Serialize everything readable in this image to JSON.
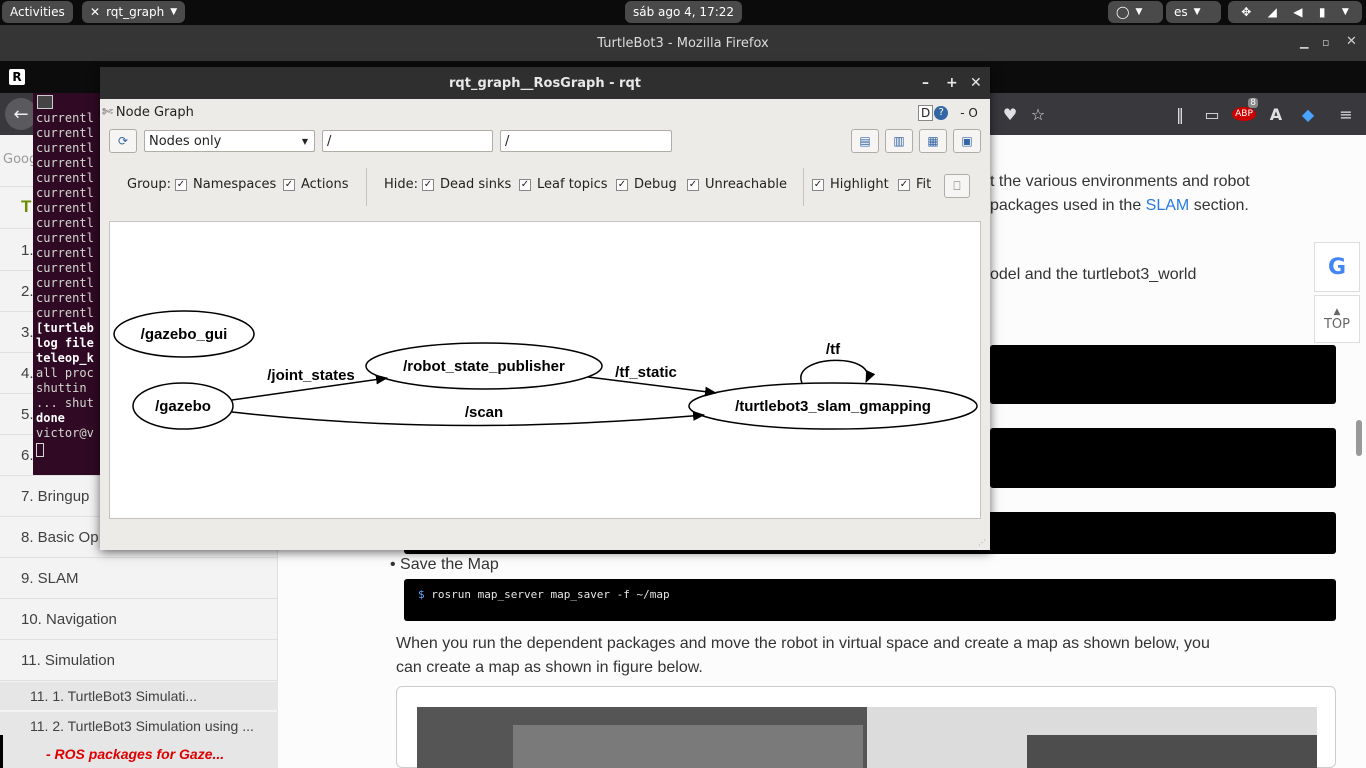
{
  "topbar": {
    "activities": "Activities",
    "app_name": "rqt_graph",
    "clock": "sáb ago  4, 17:22",
    "language": "es"
  },
  "firefox": {
    "window_title": "TurtleBot3 - Mozilla Firefox",
    "addon_badge": "8"
  },
  "terminal": {
    "lines": [
      "currentl",
      "currentl",
      "currentl",
      "currentl",
      "currentl",
      "currentl",
      "currentl",
      "currentl",
      "currentl",
      "currentl",
      "currentl",
      "currentl",
      "currentl",
      "currentl",
      "[turtleb",
      "log file",
      "teleop_k",
      "all proc",
      "shuttin",
      "... shut",
      "done",
      "victor@v"
    ]
  },
  "rqt": {
    "window_title": "rqt_graph__RosGraph - rqt",
    "plugin_title": "Node Graph",
    "help_d": "D",
    "help_o": "- O",
    "display_mode": "Nodes only",
    "ns_filter": "/",
    "topic_filter": "/",
    "group_label": "Group:",
    "namespaces": "Namespaces",
    "actions": "Actions",
    "hide_label": "Hide:",
    "dead_sinks": "Dead sinks",
    "leaf_topics": "Leaf topics",
    "debug": "Debug",
    "unreachable": "Unreachable",
    "highlight": "Highlight",
    "fit": "Fit",
    "checkmark": "✓"
  },
  "graph": {
    "nodes": {
      "gazebo_gui": "/gazebo_gui",
      "gazebo": "/gazebo",
      "robot_state_publisher": "/robot_state_publisher",
      "slam_gmapping": "/turtlebot3_slam_gmapping"
    },
    "edges": {
      "joint_states": "/joint_states",
      "scan": "/scan",
      "tf_static": "/tf_static",
      "tf": "/tf"
    }
  },
  "sidebar": {
    "partial_heading": "T",
    "items": [
      "1.",
      "2.",
      "3.",
      "4.",
      "5.",
      "6.",
      "7. Bringup",
      "8. Basic Op",
      "9. SLAM",
      "10. Navigation",
      "11. Simulation"
    ],
    "subitems": [
      "11. 1. TurtleBot3 Simulati...",
      "11. 2. TurtleBot3 Simulation using ..."
    ],
    "active_sub": "- ROS packages for Gaze..."
  },
  "content": {
    "para1_line1": "t the various environments and robot",
    "para1_line2a": "packages used in the ",
    "slam_link": "SLAM",
    "para1_line2b": " section.",
    "para2": "odel and the turtlebot3_world",
    "save_map_bullet": "Save the Map",
    "save_map_cmd_prompt": "$",
    "save_map_cmd": " rosrun map_server map_saver -f ~/map",
    "para3_line1": "When you run the dependent packages and move the robot in virtual space and create a map as shown below, you",
    "para3_line2": "can create a map as shown in figure below.",
    "top_button": "TOP",
    "google_g": "G",
    "google_partial": "Googl"
  }
}
